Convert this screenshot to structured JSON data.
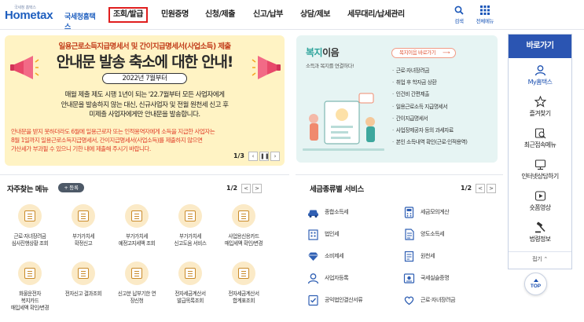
{
  "header": {
    "logo": "Hometax",
    "logo_tagline": "국세청 홈택스",
    "logo_sub": "국세청홈택스",
    "nav": [
      "조회/발급",
      "민원증명",
      "신청/제출",
      "신고/납부",
      "상담/제보",
      "세무대리/납세관리"
    ],
    "active_nav": "조회/발급",
    "search_label": "검색",
    "menu_label": "전체메뉴"
  },
  "banner": {
    "subtitle": "일용근로소득지급명세서 및 간이지급명세서(사업소득) 제출",
    "title": "안내문 발송 축소에 대한 안내!",
    "date": "2022년 7월부터",
    "body": [
      "매월 제출 제도 시행 1년이 되는 '22.7월부터 모든 사업자에게",
      "안내문을 발송하지 않는 대신, 신규사업자 및 전월 원천세 신고 후",
      "미제출 사업자에게만 안내문을 발송합니다."
    ],
    "note": [
      "안내문을 받지 못하더라도 6월에 일용근로자 또는 인적용역자에게 소득을 지급한 사업자는",
      "8월 1일까지 일용근로소득지급명세서, 간이지급명세서(사업소득)를 제출하지 않으면",
      "가산세가 부과될 수 있으니 기한 내에 제출해 주시기 바랍니다."
    ],
    "pager": "1/3"
  },
  "welfare": {
    "title_accent": "복지",
    "title_rest": "이음",
    "desc": "소득과 복지를 연결하다!",
    "shortcut": "복지이음 바로가기",
    "items": [
      "근로·자녀장려금",
      "취업 후 학자금 상환",
      "인건비 간편제출",
      "일용근로소득 지급명세서",
      "간이지급명세서",
      "사업장제공자 등의 과세자료",
      "본인 소득내역 확인(근로·인적용역)"
    ]
  },
  "quick": {
    "title": "바로가기",
    "items": [
      "My홈택스",
      "즐겨찾기",
      "최근접속메뉴",
      "인터넷상담하기",
      "숏폼영상",
      "법령정보"
    ],
    "fold": "접기",
    "top": "TOP"
  },
  "favorites": {
    "title": "자주찾는 메뉴",
    "register": "+ 등록",
    "pager": "1/2",
    "items": [
      "근로·자녀장려금\n심사진행상황 조회",
      "부가가치세\n확정신고",
      "부가가치세\n예정고지세액 조회",
      "부가가치세\n신고도움 서비스",
      "사업용신용카드\n매입세액 확인/변경",
      "화물운전자\n복지카드\n매입세액 확인/변경",
      "전자신고 결과조회",
      "신고분 납부기한 연\n장신청",
      "전자세금계산서\n발급목록조회",
      "전자세금계산서\n합계표조회"
    ]
  },
  "tax_services": {
    "title": "세금종류별 서비스",
    "pager": "1/2",
    "items": [
      "종합소득세",
      "세금모의계산",
      "법인세",
      "양도소득세",
      "소비제세",
      "원천세",
      "사업자등록",
      "국세실슬증명",
      "공익법인결산서류",
      "근로·자녀장려금"
    ]
  },
  "colors": {
    "brand": "#1f5fbf",
    "active_outline": "#e01e1e",
    "banner_bg": "#fff3c4",
    "welfare_bg": "#e6f4f3",
    "quick_head": "#2b55b2"
  }
}
